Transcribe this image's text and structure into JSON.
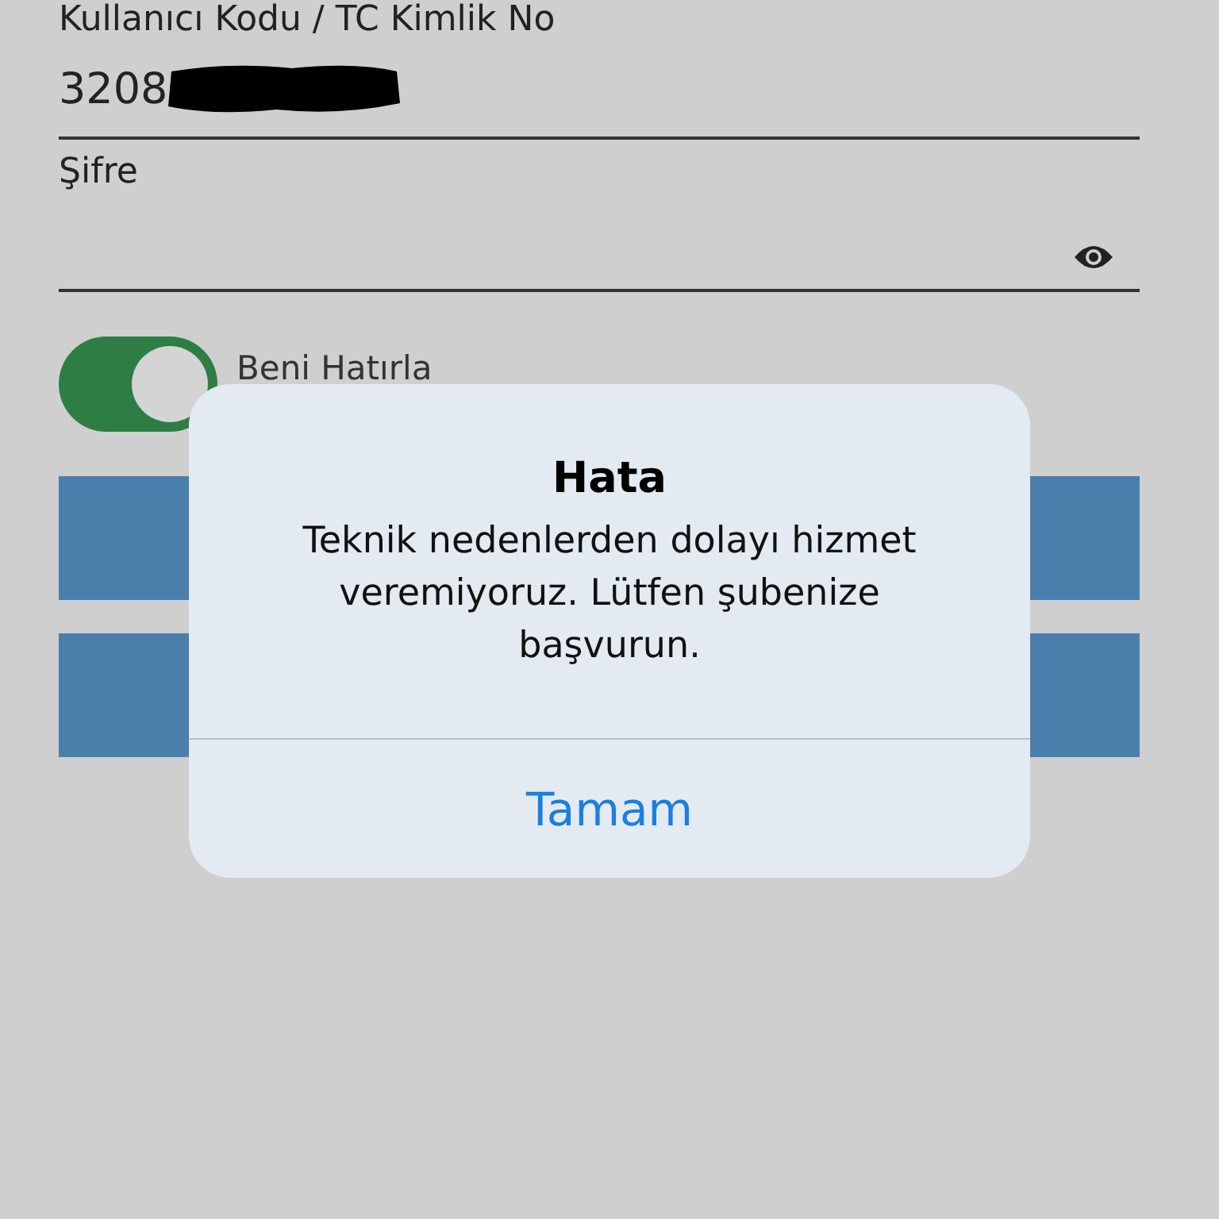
{
  "login_form": {
    "username": {
      "label": "Kullanıcı Kodu / TC Kimlik No",
      "value": "3208",
      "redacted": true
    },
    "password": {
      "label": "Şifre"
    },
    "remember_me": {
      "label": "Beni Hatırla",
      "on": true
    }
  },
  "alert": {
    "title": "Hata",
    "message": "Teknik nedenlerden dolayı hizmet veremiyoruz. Lütfen şubenize başvurun.",
    "button": "Tamam"
  }
}
